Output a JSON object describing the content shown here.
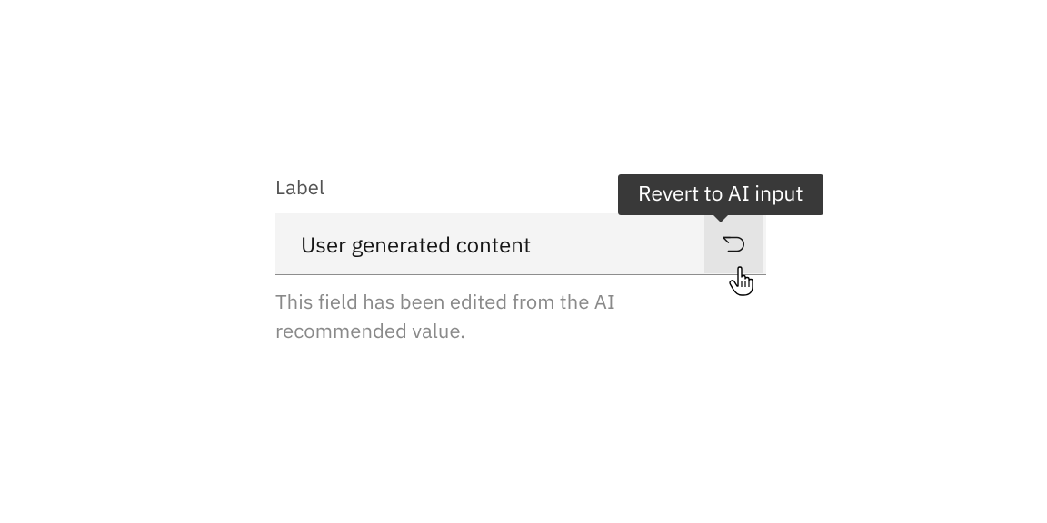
{
  "field": {
    "label": "Label",
    "value": "User generated content",
    "helper": "This field has been edited from the AI recommended value."
  },
  "tooltip": {
    "text": "Revert to AI input"
  },
  "icons": {
    "revert": "undo-icon",
    "cursor": "hand-pointer-cursor"
  }
}
